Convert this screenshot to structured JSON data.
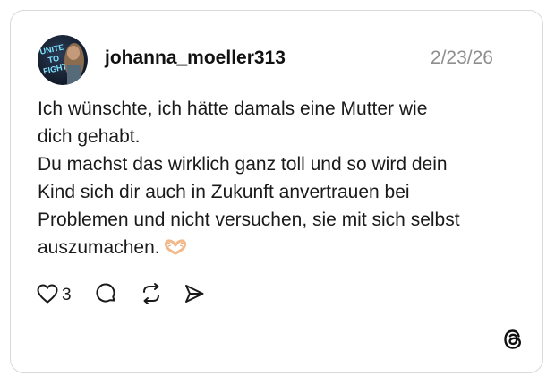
{
  "post": {
    "username": "johanna_moeller313",
    "date": "2/23/26",
    "avatar_text": [
      "UNITE",
      "TO",
      "FIGHT"
    ],
    "text_lines": [
      "Ich wünschte, ich hätte damals eine Mutter wie",
      "dich gehabt.",
      "Du machst das wirklich ganz toll und so wird dein",
      "Kind sich dir auch in Zukunft anvertrauen bei",
      "Problemen und nicht versuchen, sie mit sich selbst",
      "auszumachen."
    ],
    "trailing_emoji": "heart-hands-emoji"
  },
  "actions": {
    "like_icon": "heart-icon",
    "like_count": "3",
    "reply_icon": "comment-bubble-icon",
    "repost_icon": "repost-icon",
    "share_icon": "send-icon"
  },
  "brand": {
    "logo": "threads-logo-icon"
  },
  "colors": {
    "border": "#d9d9d9",
    "text": "#1a1a1a",
    "date": "#8e8e8e",
    "emoji": "#f3b98a"
  }
}
